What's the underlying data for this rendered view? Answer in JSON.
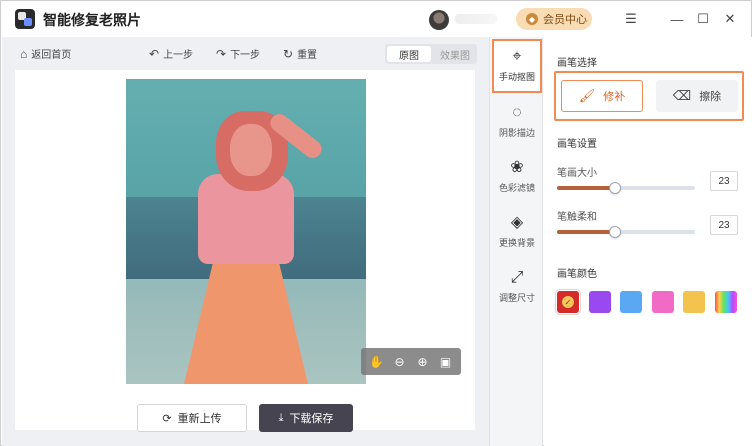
{
  "app": {
    "title": "智能修复老照片"
  },
  "header": {
    "vip_label": "会员中心"
  },
  "toolbar": {
    "back_label": "返回首页",
    "undo_label": "上一步",
    "redo_label": "下一步",
    "reset_label": "重置",
    "view_original": "原图",
    "view_result": "效果图",
    "active_view": "原图"
  },
  "actions": {
    "reupload_label": "重新上传",
    "download_label": "下载保存"
  },
  "tools": [
    {
      "label": "手动抠图",
      "icon": "cursor-icon",
      "active": true
    },
    {
      "label": "阴影描边",
      "icon": "shadow-icon",
      "active": false
    },
    {
      "label": "色彩滤镜",
      "icon": "filter-icon",
      "active": false
    },
    {
      "label": "更换背景",
      "icon": "bucket-icon",
      "active": false
    },
    {
      "label": "调整尺寸",
      "icon": "resize-icon",
      "active": false
    }
  ],
  "panel": {
    "brush_select_title": "画笔选择",
    "repair_label": "修补",
    "erase_label": "擦除",
    "brush_settings_title": "画笔设置",
    "size_label": "笔画大小",
    "size_value": "23",
    "size_fraction": 0.42,
    "softness_label": "笔触柔和",
    "softness_value": "23",
    "softness_fraction": 0.42,
    "color_title": "画笔颜色"
  },
  "brush_colors": [
    "#d42a2a",
    "#9a49f1",
    "#5aa8f4",
    "#f06ac6",
    "#f3c44d",
    "rainbow"
  ],
  "selected_color_index": 0
}
